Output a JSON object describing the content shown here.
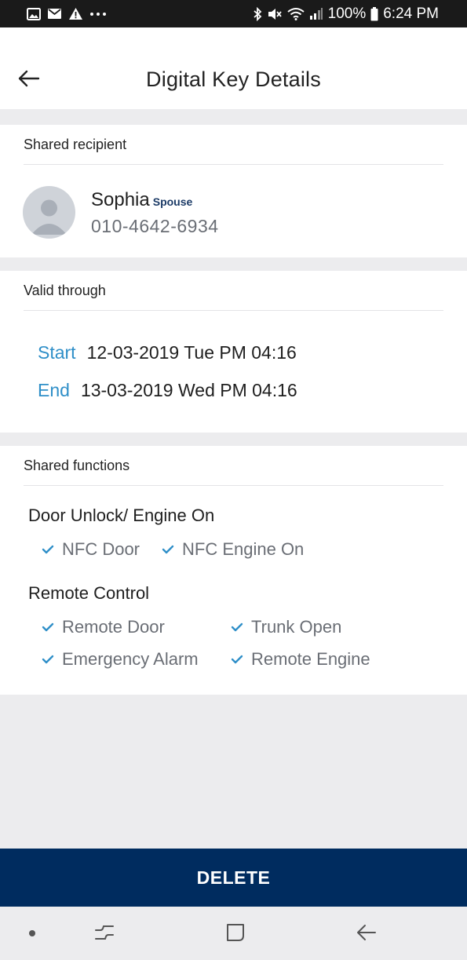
{
  "status_bar": {
    "battery": "100%",
    "time": "6:24 PM",
    "left_icons": [
      "image-icon",
      "mail-icon",
      "warning-icon",
      "more-icon"
    ],
    "right_icons": [
      "bluetooth-icon",
      "mute-icon",
      "wifi-icon",
      "signal-icon",
      "battery-icon"
    ]
  },
  "header": {
    "title": "Digital Key Details",
    "back_icon": "back-arrow-icon"
  },
  "recipient": {
    "section_label": "Shared recipient",
    "name": "Sophia",
    "relation": "Spouse",
    "phone": "010-4642-6934"
  },
  "valid_through": {
    "section_label": "Valid through",
    "start_label": "Start",
    "start_value": "12-03-2019 Tue PM 04:16",
    "end_label": "End",
    "end_value": "13-03-2019 Wed PM 04:16"
  },
  "shared_functions": {
    "section_label": "Shared functions",
    "groups": [
      {
        "title": "Door Unlock/ Engine On",
        "items": [
          "NFC Door",
          "NFC Engine On"
        ]
      },
      {
        "title": "Remote Control",
        "items": [
          "Remote Door",
          "Trunk Open",
          "Emergency Alarm",
          "Remote Engine"
        ]
      }
    ]
  },
  "actions": {
    "delete_label": "DELETE"
  },
  "colors": {
    "accent": "#2f8fc8",
    "primary_button": "#002c5f",
    "relation_text": "#1b3a66",
    "background": "#ececee"
  },
  "nav_bar": {
    "icons": [
      "dot-icon",
      "recents-icon",
      "home-icon",
      "back-icon"
    ]
  }
}
